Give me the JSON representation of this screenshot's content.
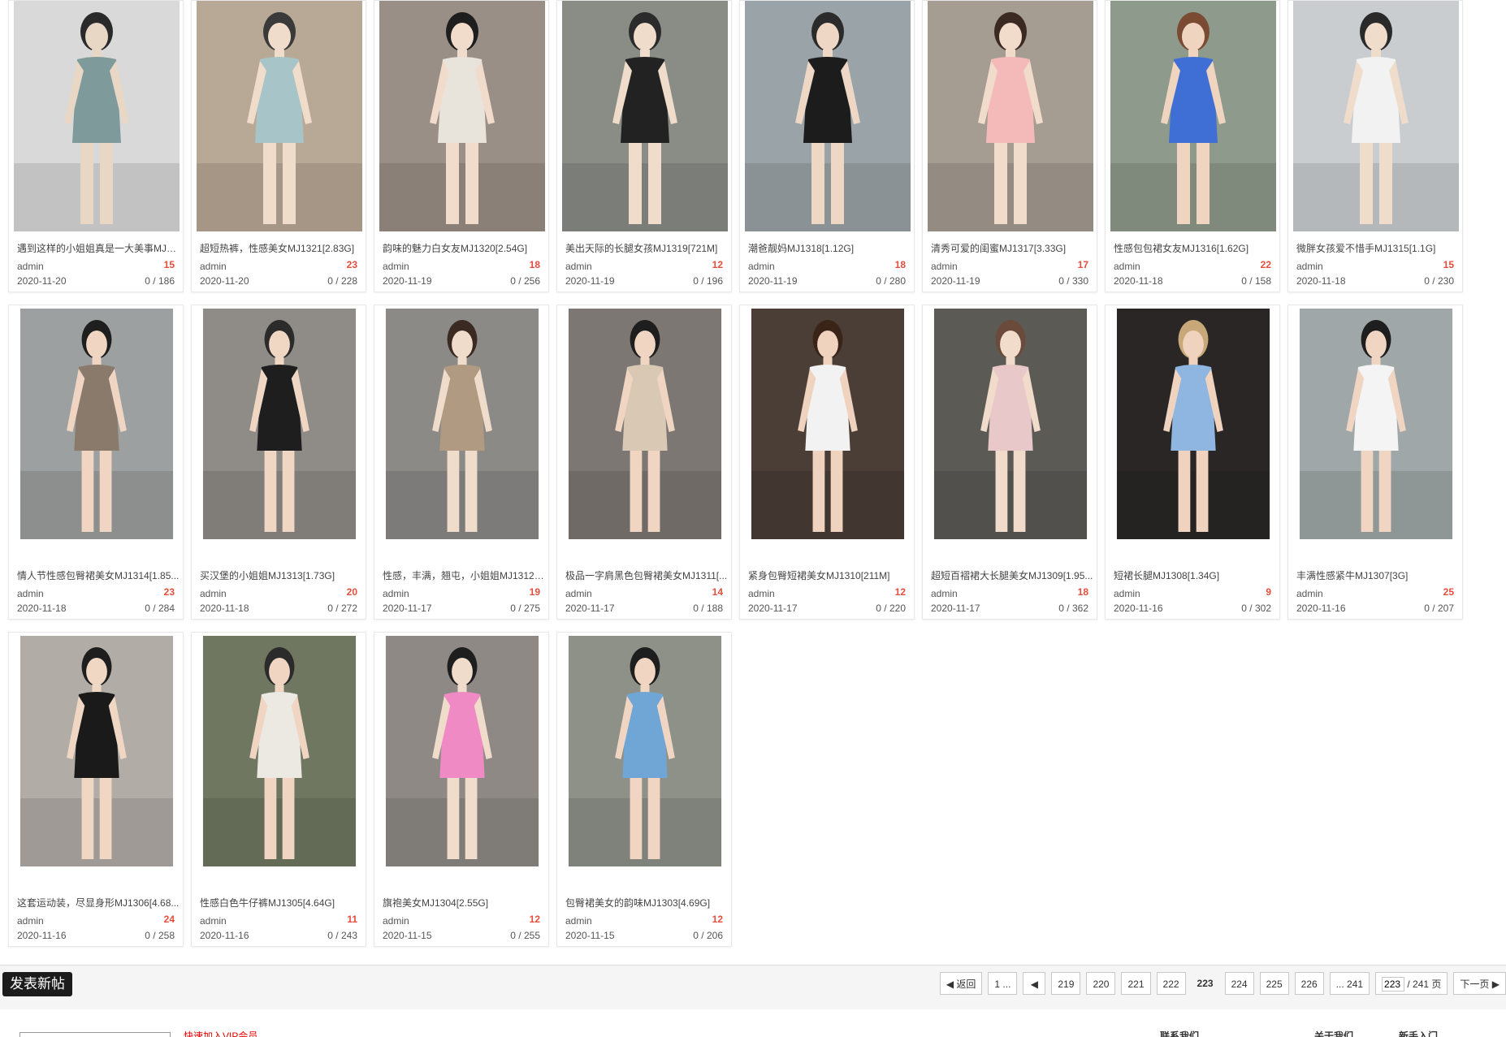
{
  "cards": [
    {
      "title": "遇到这样的小姐姐真是一大美事MJ1...",
      "author": "admin",
      "replies": "15",
      "date": "2020-11-20",
      "stats": "0 / 186",
      "palette": [
        "#d9d9d9",
        "#7f9a9a",
        "#e9d7c6",
        "#2a2a2a"
      ]
    },
    {
      "title": "超短热裤，性感美女MJ1321[2.83G]",
      "author": "admin",
      "replies": "23",
      "date": "2020-11-20",
      "stats": "0 / 228",
      "palette": [
        "#b8a896",
        "#a7c4c8",
        "#f0dccb",
        "#3a3a3a"
      ]
    },
    {
      "title": "韵味的魅力白女友MJ1320[2.54G]",
      "author": "admin",
      "replies": "18",
      "date": "2020-11-19",
      "stats": "0 / 256",
      "palette": [
        "#9a8f86",
        "#e8e4dc",
        "#f1dccb",
        "#1e1e1e"
      ]
    },
    {
      "title": "美出天际的长腿女孩MJ1319[721M]",
      "author": "admin",
      "replies": "12",
      "date": "2020-11-19",
      "stats": "0 / 196",
      "palette": [
        "#8a8d86",
        "#222222",
        "#f0dccb",
        "#2b2b2b"
      ]
    },
    {
      "title": "潮爸靓妈MJ1318[1.12G]",
      "author": "admin",
      "replies": "18",
      "date": "2020-11-19",
      "stats": "0 / 280",
      "palette": [
        "#9aa3a8",
        "#1c1c1c",
        "#efd7c5",
        "#2b2b2b"
      ]
    },
    {
      "title": "清秀可爱的闺蜜MJ1317[3.33G]",
      "author": "admin",
      "replies": "17",
      "date": "2020-11-19",
      "stats": "0 / 330",
      "palette": [
        "#a59c92",
        "#f4b9b9",
        "#f1dccb",
        "#3a2a22"
      ]
    },
    {
      "title": "性感包包裙女友MJ1316[1.62G]",
      "author": "admin",
      "replies": "22",
      "date": "2020-11-18",
      "stats": "0 / 158",
      "palette": [
        "#8e9a8c",
        "#3f6fd4",
        "#efd4c0",
        "#7a4a32"
      ]
    },
    {
      "title": "微胖女孩爱不惜手MJ1315[1.1G]",
      "author": "admin",
      "replies": "15",
      "date": "2020-11-18",
      "stats": "0 / 230",
      "palette": [
        "#c9cdd0",
        "#f2f2f2",
        "#f0dccb",
        "#2a2a2a"
      ]
    },
    {
      "title": "情人节性感包臀裙美女MJ1314[1.85...",
      "author": "admin",
      "replies": "23",
      "date": "2020-11-18",
      "stats": "0 / 284",
      "palette": [
        "#9da0a0",
        "#8a7a6c",
        "#efd5c2",
        "#1e1e1e"
      ]
    },
    {
      "title": "买汉堡的小姐姐MJ1313[1.73G]",
      "author": "admin",
      "replies": "20",
      "date": "2020-11-18",
      "stats": "0 / 272",
      "palette": [
        "#8f8b86",
        "#1e1e1e",
        "#efd7c4",
        "#2b2b2b"
      ]
    },
    {
      "title": "性感，丰满，翘屯，小姐姐MJ1312[...",
      "author": "admin",
      "replies": "19",
      "date": "2020-11-17",
      "stats": "0 / 275",
      "palette": [
        "#8b8a87",
        "#b09a82",
        "#f0dccb",
        "#3a2a22"
      ]
    },
    {
      "title": "极品一字肩黑色包臀裙美女MJ1311[...",
      "author": "admin",
      "replies": "14",
      "date": "2020-11-17",
      "stats": "0 / 188",
      "palette": [
        "#7d7773",
        "#d8c8b4",
        "#efd5c2",
        "#1e1e1e"
      ]
    },
    {
      "title": "紧身包臀短裙美女MJ1310[211M]",
      "author": "admin",
      "replies": "12",
      "date": "2020-11-17",
      "stats": "0 / 220",
      "palette": [
        "#4a3e36",
        "#f2f2f2",
        "#efd3bf",
        "#3a2418"
      ]
    },
    {
      "title": "超短百褶裙大长腿美女MJ1309[1.95...",
      "author": "admin",
      "replies": "18",
      "date": "2020-11-17",
      "stats": "0 / 362",
      "palette": [
        "#5b5a55",
        "#e8c8c8",
        "#f1dccb",
        "#6a4a3a"
      ]
    },
    {
      "title": "短裙长腿MJ1308[1.34G]",
      "author": "admin",
      "replies": "9",
      "date": "2020-11-16",
      "stats": "0 / 302",
      "palette": [
        "#2a2626",
        "#8eb6e0",
        "#efd3bf",
        "#c8a878"
      ]
    },
    {
      "title": "丰满性感紧牛MJ1307[3G]",
      "author": "admin",
      "replies": "25",
      "date": "2020-11-16",
      "stats": "0 / 207",
      "palette": [
        "#9fa7a8",
        "#f4f4f4",
        "#efd5c2",
        "#1e1e1e"
      ]
    },
    {
      "title": "这套运动装，尽显身形MJ1306[4.68...",
      "author": "admin",
      "replies": "24",
      "date": "2020-11-16",
      "stats": "0 / 258",
      "palette": [
        "#b1aca6",
        "#1a1a1a",
        "#efd7c4",
        "#1e1e1e"
      ]
    },
    {
      "title": "性感白色牛仔裤MJ1305[4.64G]",
      "author": "admin",
      "replies": "11",
      "date": "2020-11-16",
      "stats": "0 / 243",
      "palette": [
        "#6f7760",
        "#ece8e2",
        "#efd5c2",
        "#2b2b2b"
      ]
    },
    {
      "title": "旗袍美女MJ1304[2.55G]",
      "author": "admin",
      "replies": "12",
      "date": "2020-11-15",
      "stats": "0 / 255",
      "palette": [
        "#8e8985",
        "#f08ac4",
        "#f0dccb",
        "#1e1e1e"
      ]
    },
    {
      "title": "包臀裙美女的韵味MJ1303[4.69G]",
      "author": "admin",
      "replies": "12",
      "date": "2020-11-15",
      "stats": "0 / 206",
      "palette": [
        "#8d9188",
        "#6fa6d6",
        "#efd5c2",
        "#1e1e1e"
      ]
    }
  ],
  "toolbar": {
    "new_post": "发表新帖"
  },
  "pagination": {
    "back": "返回",
    "first": "1 ...",
    "pages": [
      "219",
      "220",
      "221",
      "222",
      "223",
      "224",
      "225",
      "226"
    ],
    "current": "223",
    "last": "... 241",
    "input_value": "223",
    "total_label": "/ 241 页",
    "next": "下一页"
  },
  "footer": {
    "red_link": "快速加入VIP会员",
    "links": [
      "联系我们",
      "关于我们",
      "新手入门"
    ]
  }
}
